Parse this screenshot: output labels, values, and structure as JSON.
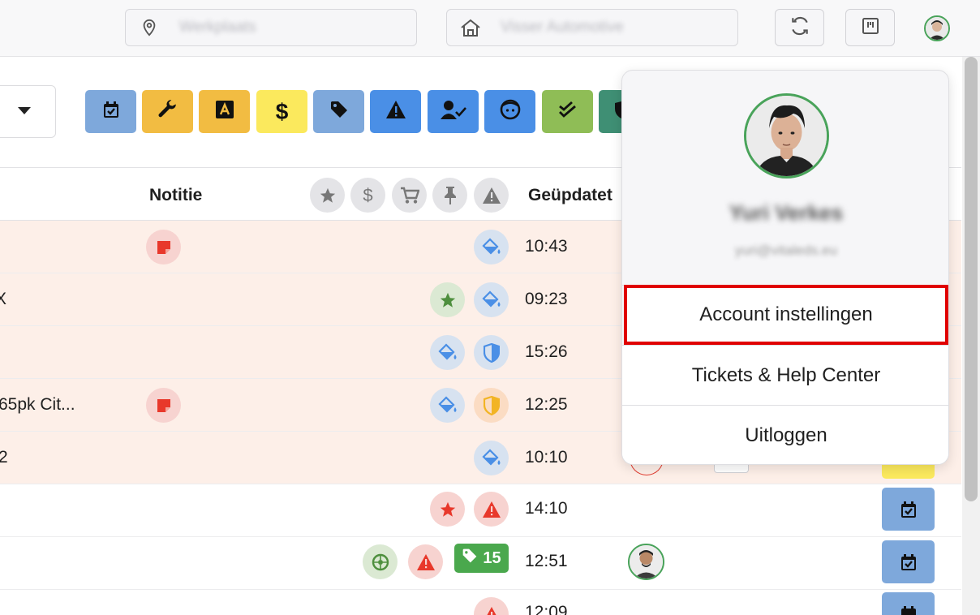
{
  "header": {
    "location_placeholder": "Werkplaats",
    "company_placeholder": "Visser Automotive",
    "icons": [
      "map-pin-icon",
      "home-icon",
      "refresh-icon",
      "board-icon"
    ]
  },
  "filters": {
    "buttons": [
      {
        "icon": "calendar-check-icon",
        "color": "#7ea8db"
      },
      {
        "icon": "wrench-icon",
        "color": "#f2bc42"
      },
      {
        "icon": "a-square-icon",
        "color": "#f2bc42"
      },
      {
        "icon": "dollar-icon",
        "color": "#fbe95d"
      },
      {
        "icon": "tag-icon",
        "color": "#7ea8db"
      },
      {
        "icon": "warning-icon",
        "color": "#4a8fe6"
      },
      {
        "icon": "user-check-icon",
        "color": "#4a8fe6"
      },
      {
        "icon": "face-icon",
        "color": "#4a8fe6"
      },
      {
        "icon": "double-check-icon",
        "color": "#8fbd56"
      },
      {
        "icon": "shield-icon",
        "color": "#3f8f74"
      }
    ]
  },
  "table": {
    "headers": {
      "note": "Notitie",
      "updated": "Geüpdatet"
    },
    "header_icons": [
      "star-icon",
      "dollar-icon",
      "cart-icon",
      "pin-icon",
      "warning-icon"
    ],
    "rows": [
      {
        "text": "",
        "time": "10:43"
      },
      {
        "text": "X",
        "time": "09:23"
      },
      {
        "text": "",
        "time": "15:26"
      },
      {
        "text": "65pk Cit...",
        "time": "12:25"
      },
      {
        "text": "2",
        "time": "10:10"
      },
      {
        "text": "",
        "time": "14:10"
      },
      {
        "text": "",
        "time": "12:51",
        "tag_count": "15"
      },
      {
        "text": "",
        "time": "12:09"
      }
    ]
  },
  "user_menu": {
    "name": "Yuri Verkes",
    "email": "yuri@vitaleds.eu",
    "items": [
      {
        "label": "Account instellingen"
      },
      {
        "label": "Tickets & Help Center"
      },
      {
        "label": "Uitloggen"
      }
    ]
  },
  "colors": {
    "highlight": "#e00000",
    "avatar_ring": "#49a35a",
    "row_pink": "#fdefe8"
  }
}
